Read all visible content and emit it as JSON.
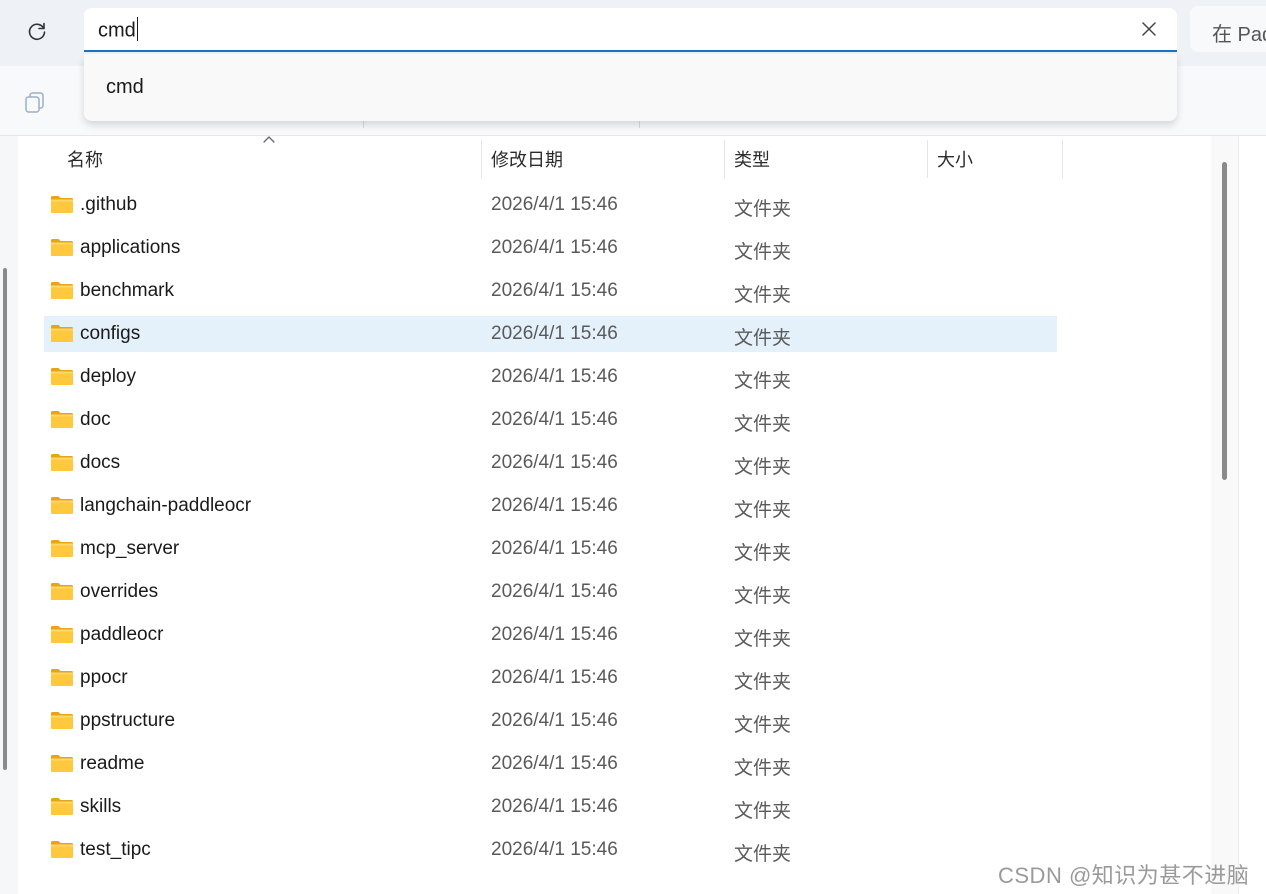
{
  "address_bar": {
    "value": "cmd"
  },
  "search_box": {
    "text": "在 Pad"
  },
  "suggestion": {
    "label": "cmd"
  },
  "columns": {
    "name": "名称",
    "date": "修改日期",
    "type": "类型",
    "size": "大小"
  },
  "files": [
    {
      "name": ".github",
      "date": "2026/4/1 15:46",
      "type": "文件夹"
    },
    {
      "name": "applications",
      "date": "2026/4/1 15:46",
      "type": "文件夹"
    },
    {
      "name": "benchmark",
      "date": "2026/4/1 15:46",
      "type": "文件夹"
    },
    {
      "name": "configs",
      "date": "2026/4/1 15:46",
      "type": "文件夹",
      "selected": true
    },
    {
      "name": "deploy",
      "date": "2026/4/1 15:46",
      "type": "文件夹"
    },
    {
      "name": "doc",
      "date": "2026/4/1 15:46",
      "type": "文件夹"
    },
    {
      "name": "docs",
      "date": "2026/4/1 15:46",
      "type": "文件夹"
    },
    {
      "name": "langchain-paddleocr",
      "date": "2026/4/1 15:46",
      "type": "文件夹"
    },
    {
      "name": "mcp_server",
      "date": "2026/4/1 15:46",
      "type": "文件夹"
    },
    {
      "name": "overrides",
      "date": "2026/4/1 15:46",
      "type": "文件夹"
    },
    {
      "name": "paddleocr",
      "date": "2026/4/1 15:46",
      "type": "文件夹"
    },
    {
      "name": "ppocr",
      "date": "2026/4/1 15:46",
      "type": "文件夹"
    },
    {
      "name": "ppstructure",
      "date": "2026/4/1 15:46",
      "type": "文件夹"
    },
    {
      "name": "readme",
      "date": "2026/4/1 15:46",
      "type": "文件夹"
    },
    {
      "name": "skills",
      "date": "2026/4/1 15:46",
      "type": "文件夹"
    },
    {
      "name": "test_tipc",
      "date": "2026/4/1 15:46",
      "type": "文件夹"
    }
  ],
  "icons": {
    "refresh": "refresh-icon",
    "clear": "close-icon",
    "copy": "copy-icon",
    "folder": "folder-icon",
    "sort": "chevron-up-icon"
  },
  "colors": {
    "accent": "#1f6fc2",
    "selected_row": "#e4f1fb",
    "folder": "#f4c430"
  },
  "watermark": "CSDN @知识为甚不进脑"
}
